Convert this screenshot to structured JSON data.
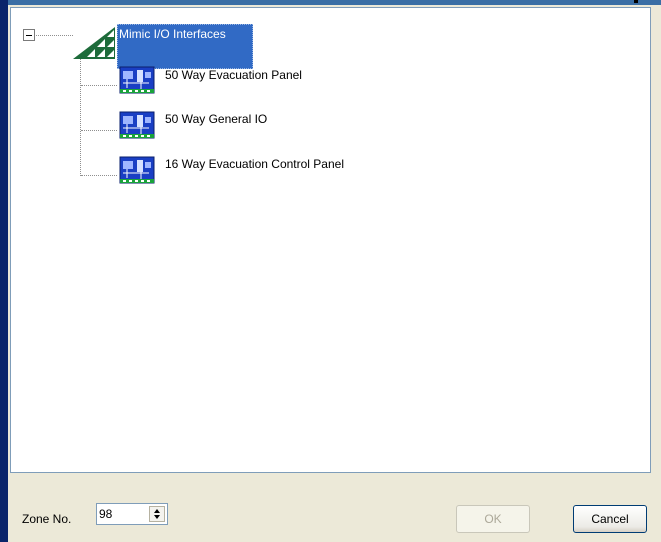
{
  "tree": {
    "root": {
      "label": "Mimic I/O Interfaces",
      "expanded": true,
      "selected": true,
      "icon": "green-triangle-network-icon"
    },
    "children": [
      {
        "label": "50 Way Evacuation Panel",
        "icon": "circuit-board-icon"
      },
      {
        "label": "50 Way General IO",
        "icon": "circuit-board-icon"
      },
      {
        "label": "16 Way Evacuation Control Panel",
        "icon": "circuit-board-icon"
      }
    ]
  },
  "footer": {
    "zone_label": "Zone No.",
    "zone_value": "98",
    "ok_label": "OK",
    "ok_enabled": false,
    "cancel_label": "Cancel"
  },
  "colors": {
    "selection": "#316ac5",
    "dialog_bg": "#ece9d8",
    "title_accent": "#3a6ea5",
    "left_border": "#0a246a"
  }
}
